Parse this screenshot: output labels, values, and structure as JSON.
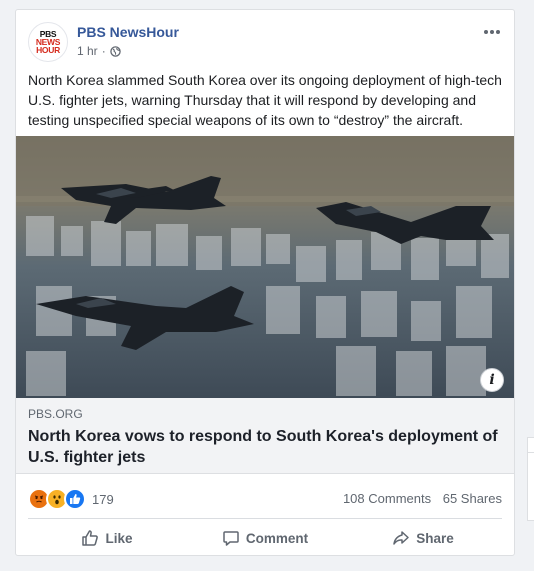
{
  "post": {
    "page_name": "PBS NewsHour",
    "avatar_logo": [
      "PBS",
      "NEWS",
      "HOUR"
    ],
    "timestamp": "1 hr",
    "separator": "·",
    "privacy_icon": "globe-icon",
    "more_icon": "ellipsis-icon",
    "text": "North Korea slammed South Korea over its ongoing deployment of high-tech U.S. fighter jets, warning Thursday that it will respond by developing and testing unspecified special weapons of its own to “destroy” the aircraft."
  },
  "link_preview": {
    "domain": "PBS.ORG",
    "title": "North Korea vows to respond to South Korea's deployment of U.S. fighter jets",
    "info_icon": "i"
  },
  "stats": {
    "reactions": [
      "angry-icon",
      "wow-icon",
      "like-icon"
    ],
    "reaction_count": "179",
    "comments": "108 Comments",
    "shares": "65 Shares"
  },
  "actions": {
    "like": "Like",
    "comment": "Comment",
    "share": "Share"
  },
  "colors": {
    "name": "#365899",
    "like_blue": "#1877f2",
    "angry": "#e9710f",
    "wow": "#f7b125"
  }
}
